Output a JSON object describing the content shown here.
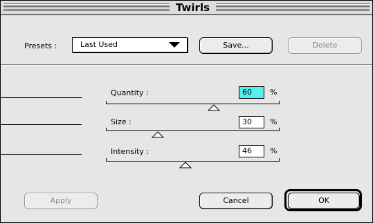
{
  "window": {
    "title": "Twirls"
  },
  "presets": {
    "label": "Presets :",
    "selected": "Last Used",
    "save_label": "Save...",
    "delete_label": "Delete"
  },
  "sliders": [
    {
      "label": "Quantity :",
      "value": "60",
      "unit": "%",
      "fraction": 0.62,
      "active": true
    },
    {
      "label": "Size :",
      "value": "30",
      "unit": "%",
      "fraction": 0.3
    },
    {
      "label": "Intensity :",
      "value": "46",
      "unit": "%",
      "fraction": 0.46
    }
  ],
  "buttons": {
    "apply": "Apply",
    "cancel": "Cancel",
    "ok": "OK"
  },
  "colors": {
    "active_field": "#55efef",
    "window_bg": "#e6e6e6"
  }
}
